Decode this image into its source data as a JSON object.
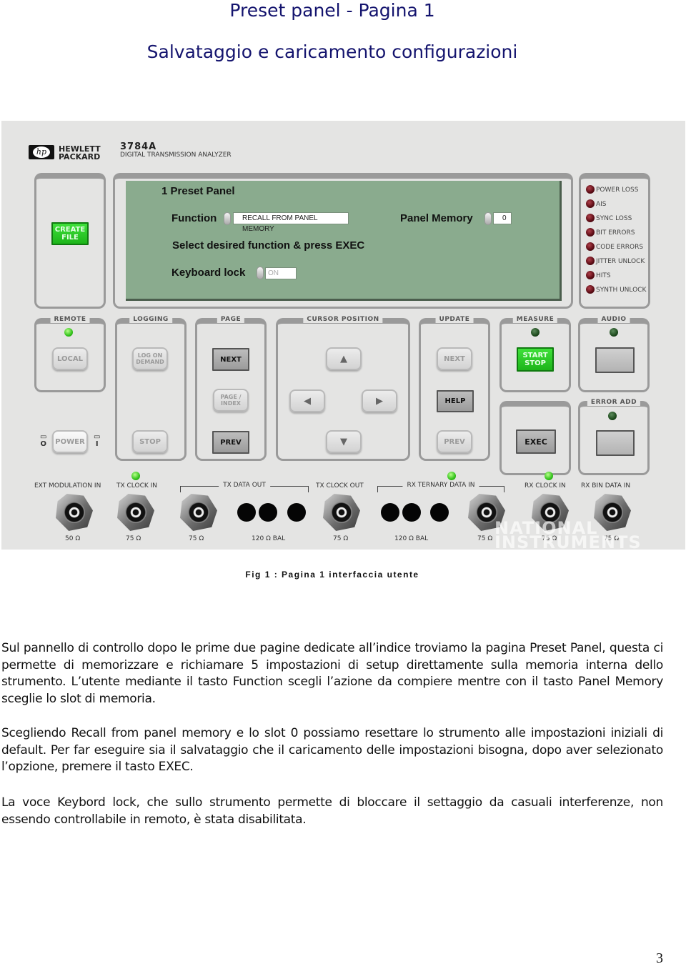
{
  "header": {
    "title": "Preset panel - Pagina 1",
    "subtitle": "Salvataggio e caricamento configurazioni"
  },
  "instrument": {
    "brand_line1": "HEWLETT",
    "brand_line2": "PACKARD",
    "logo_text": "hp",
    "model": "3784A",
    "model_desc": "DIGITAL TRANSMISSION ANALYZER",
    "create_file_button": "CREATE FILE",
    "screen": {
      "title": "1 Preset Panel",
      "function_label": "Function",
      "function_value": "RECALL FROM PANEL MEMORY",
      "panel_memory_label": "Panel Memory",
      "panel_memory_value": "0",
      "instruction": "Select desired function & press EXEC",
      "keyboard_lock_label": "Keyboard lock",
      "keyboard_lock_value": "ON"
    },
    "alarms": [
      {
        "label": "POWER LOSS",
        "state": "off"
      },
      {
        "label": "AIS",
        "state": "off"
      },
      {
        "label": "SYNC LOSS",
        "state": "off"
      },
      {
        "label": "BIT ERRORS",
        "state": "off"
      },
      {
        "label": "CODE ERRORS",
        "state": "off"
      },
      {
        "label": "JITTER UNLOCK",
        "state": "off"
      },
      {
        "label": "HITS",
        "state": "off"
      },
      {
        "label": "SYNTH UNLOCK",
        "state": "off"
      }
    ],
    "groups": {
      "remote": {
        "label": "REMOTE",
        "led": "on",
        "button": "LOCAL"
      },
      "logging": {
        "label": "LOGGING",
        "button_top": "LOG ON DEMAND",
        "button_bottom": "STOP"
      },
      "page": {
        "label": "PAGE",
        "next": "NEXT",
        "index": "PAGE / INDEX",
        "prev": "PREV"
      },
      "cursor": {
        "label": "CURSOR POSITION",
        "up": "▲",
        "left": "◀",
        "right": "▶",
        "down": "▼"
      },
      "update": {
        "label": "UPDATE",
        "next": "NEXT",
        "help": "HELP",
        "prev": "PREV"
      },
      "measure": {
        "label": "MEASURE",
        "led": "off",
        "button": "START STOP"
      },
      "audio": {
        "label": "AUDIO",
        "led": "off"
      },
      "exec": {
        "button": "EXEC"
      },
      "error_add": {
        "label": "ERROR ADD",
        "led": "off"
      },
      "power": {
        "button": "POWER",
        "off_symbol": "O",
        "on_symbol": "I"
      }
    },
    "connectors": [
      {
        "label": "EXT MODULATION IN",
        "impedance": "50 Ω"
      },
      {
        "label": "TX CLOCK IN",
        "impedance": "75 Ω",
        "led": "on"
      },
      {
        "label": "TX DATA OUT",
        "impedance_coax": "75 Ω",
        "impedance_bal": "120 Ω BAL"
      },
      {
        "label": "TX CLOCK OUT",
        "impedance": "75 Ω"
      },
      {
        "label": "RX TERNARY DATA IN",
        "impedance_bal": "120 Ω BAL",
        "impedance_coax": "75 Ω",
        "led": "on"
      },
      {
        "label": "RX CLOCK IN",
        "impedance": "75 Ω",
        "led": "on"
      },
      {
        "label": "RX BIN DATA IN",
        "impedance": "75 Ω"
      }
    ],
    "watermark_line1": "NATIONAL",
    "watermark_line2": "INSTRUMENTS"
  },
  "caption": "Fig 1 :  Pagina 1 interfaccia utente",
  "paragraphs": [
    "Sul pannello di controllo dopo le prime due pagine dedicate all’indice troviamo la pagina Preset Panel, questa ci permette di memorizzare e richiamare 5 impostazioni di setup direttamente sulla memoria interna dello strumento. L’utente  mediante il tasto Function scegli l’azione da compiere mentre con il tasto Panel Memory sceglie lo slot di memoria.",
    "Scegliendo Recall from panel memory e lo slot 0 possiamo resettare lo strumento alle impostazioni iniziali di default. Per far eseguire sia il salvataggio che il caricamento delle impostazioni bisogna, dopo aver selezionato l’opzione, premere il tasto EXEC.",
    "La voce Keybord lock, che sullo strumento permette di bloccare il settaggio da casuali interferenze, non essendo controllabile in remoto, è stata disabilitata."
  ],
  "page_number": "3"
}
